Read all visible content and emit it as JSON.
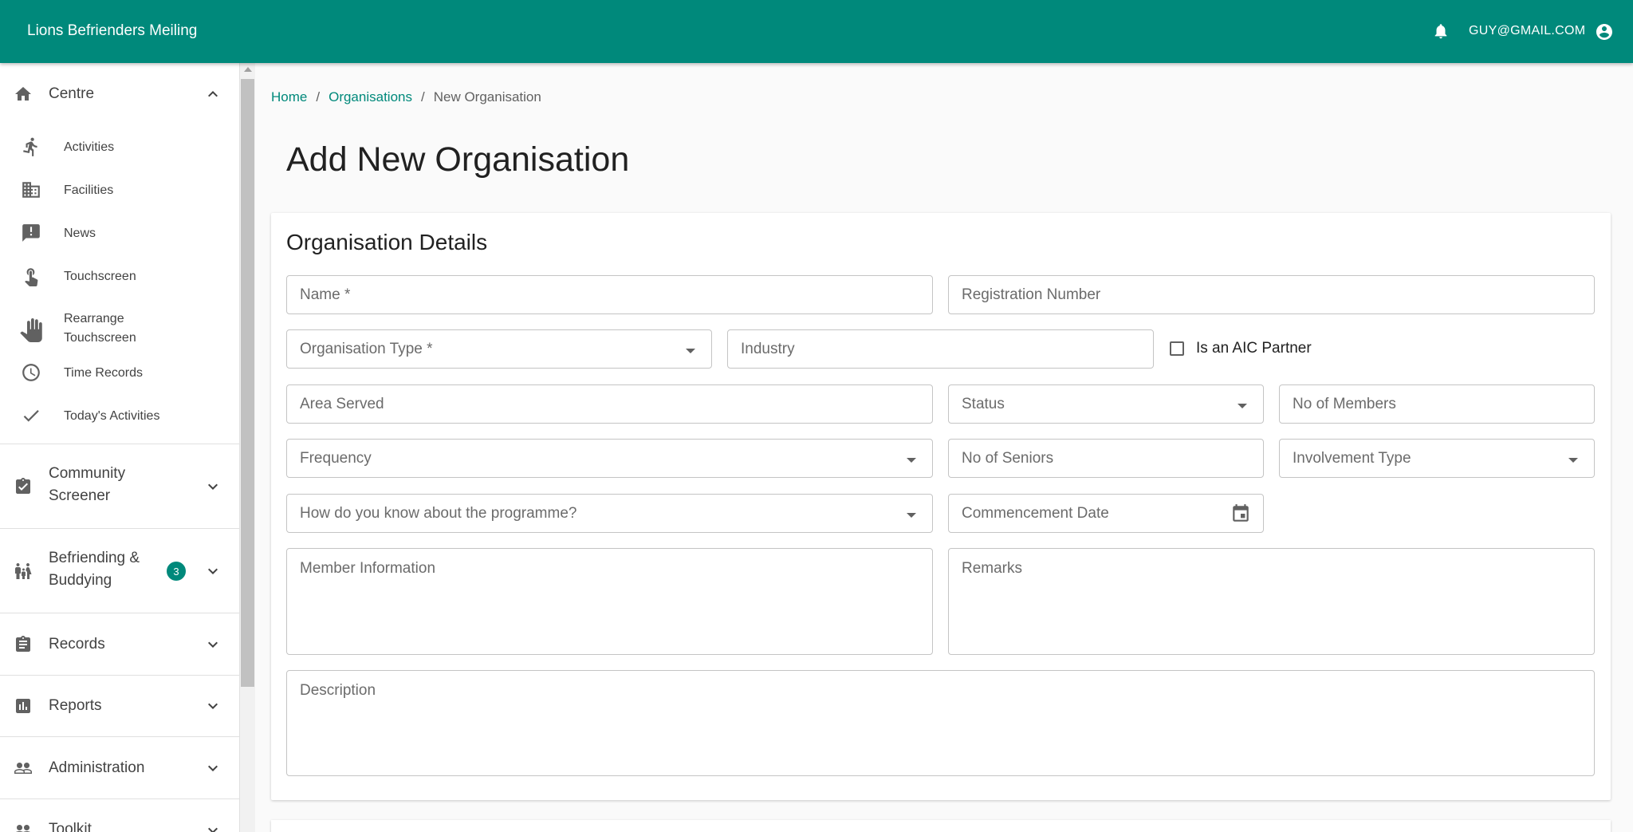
{
  "app": {
    "title": "Lions Befrienders Meiling",
    "user_email": "GUY@GMAIL.COM"
  },
  "sidebar": {
    "groups": [
      {
        "label": "Centre",
        "icon": "home-icon",
        "expanded": true
      },
      {
        "label": "Community Screener",
        "icon": "clipboard-check-icon"
      },
      {
        "label": "Befriending & Buddying",
        "icon": "family-icon",
        "badge": "3"
      },
      {
        "label": "Records",
        "icon": "clipboard-icon"
      },
      {
        "label": "Reports",
        "icon": "bar-chart-icon"
      },
      {
        "label": "Administration",
        "icon": "people-icon"
      },
      {
        "label": "Toolkit",
        "icon": "people-icon"
      }
    ],
    "centre_items": [
      {
        "label": "Activities",
        "icon": "running-icon"
      },
      {
        "label": "Facilities",
        "icon": "building-icon"
      },
      {
        "label": "News",
        "icon": "announcement-icon"
      },
      {
        "label": "Touchscreen",
        "icon": "touch-icon"
      },
      {
        "label": "Rearrange Touchscreen",
        "icon": "hand-icon"
      },
      {
        "label": "Time Records",
        "icon": "clock-icon"
      },
      {
        "label": "Today's Activities",
        "icon": "check-icon"
      }
    ]
  },
  "breadcrumb": {
    "home": "Home",
    "organisations": "Organisations",
    "current": "New Organisation",
    "separator": "/"
  },
  "page_title": "Add New Organisation",
  "card": {
    "title": "Organisation Details",
    "fields": {
      "name": "Name *",
      "registration_number": "Registration Number",
      "organisation_type": "Organisation Type *",
      "industry": "Industry",
      "aic_partner": "Is an AIC Partner",
      "area_served": "Area Served",
      "status": "Status",
      "no_of_members": "No of Members",
      "frequency": "Frequency",
      "no_of_seniors": "No of Seniors",
      "involvement_type": "Involvement Type",
      "how_know": "How do you know about the programme?",
      "commencement_date": "Commencement Date",
      "member_information": "Member Information",
      "remarks": "Remarks",
      "description": "Description"
    }
  },
  "colors": {
    "primary": "#00897b",
    "sidebar_text": "#424242",
    "placeholder": "#6b6b6b"
  }
}
